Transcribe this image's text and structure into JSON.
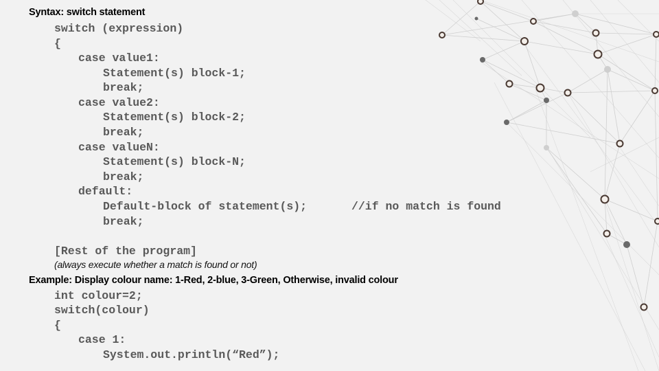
{
  "syntax_heading": "Syntax: switch statement",
  "syntax_code": [
    "switch (expression)",
    "{",
    "case value1:",
    "Statement(s) block-1;",
    "break;",
    "case value2:",
    "Statement(s) block-2;",
    "break;",
    "case valueN:",
    "Statement(s) block-N;",
    "break;",
    "default:",
    "Default-block of statement(s);",
    "break;"
  ],
  "default_comment": "//if no match is found",
  "rest_label": "[Rest of the program]",
  "rest_note": "(always execute whether a match is found or not)",
  "example_heading": "Example: Display colour name: 1-Red, 2-blue, 3-Green, Otherwise, invalid colour",
  "example_code": [
    "int colour=2;",
    "switch(colour)",
    "{",
    "case 1:",
    "System.out.println(“Red”);"
  ],
  "colors": {
    "background": "#f2f2f2",
    "code_text": "#595959",
    "heading_text": "#000000",
    "network_line": "#cfcfcf"
  }
}
